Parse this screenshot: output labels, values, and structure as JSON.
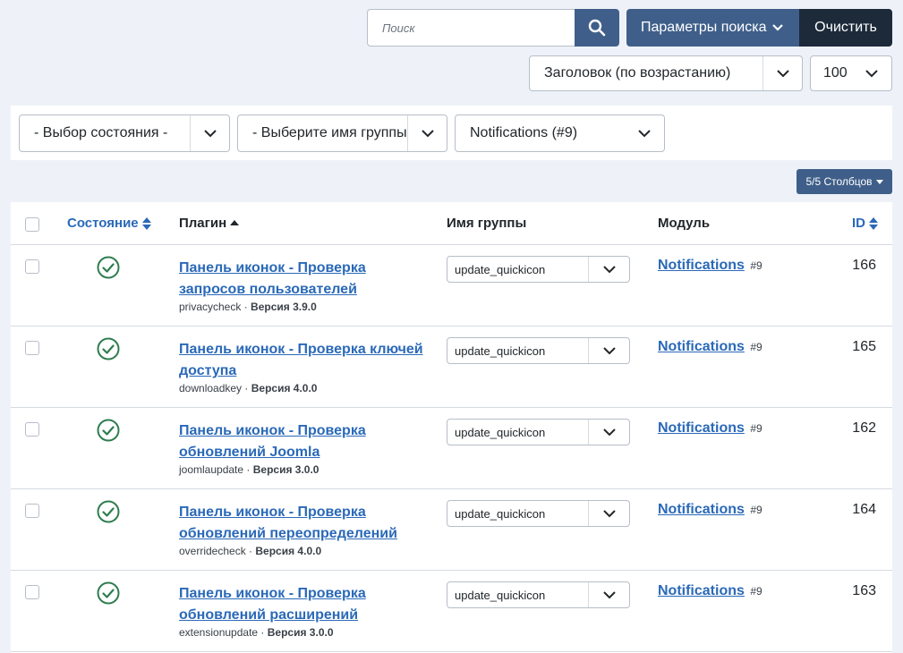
{
  "search": {
    "placeholder": "Поиск",
    "params_label": "Параметры поиска",
    "clear_label": "Очистить"
  },
  "ordering": {
    "sort_value": "Заголовок (по возрастанию)",
    "limit_value": "100"
  },
  "filters": {
    "state": "- Выбор состояния -",
    "group": "- Выберите имя группы",
    "module": "Notifications (#9)"
  },
  "columns_button": "5/5 Столбцов",
  "table": {
    "headers": {
      "state": "Состояние",
      "plugin": "Плагин",
      "group": "Имя группы",
      "module": "Модуль",
      "id": "ID"
    },
    "rows": [
      {
        "title_line1": "Панель иконок - Проверка",
        "title_line2": "запросов пользователей",
        "element": "privacycheck",
        "version_label": "Версия 3.9.0",
        "group": "update_quickicon",
        "module": "Notifications",
        "module_num": "#9",
        "id": "166"
      },
      {
        "title_line1": "Панель иконок - Проверка ключей",
        "title_line2": "доступа",
        "element": "downloadkey",
        "version_label": "Версия 4.0.0",
        "group": "update_quickicon",
        "module": "Notifications",
        "module_num": "#9",
        "id": "165"
      },
      {
        "title_line1": "Панель иконок - Проверка",
        "title_line2": "обновлений Joomla",
        "element": "joomlaupdate",
        "version_label": "Версия 3.0.0",
        "group": "update_quickicon",
        "module": "Notifications",
        "module_num": "#9",
        "id": "162"
      },
      {
        "title_line1": "Панель иконок - Проверка",
        "title_line2": "обновлений переопределений",
        "element": "overridecheck",
        "version_label": "Версия 4.0.0",
        "group": "update_quickicon",
        "module": "Notifications",
        "module_num": "#9",
        "id": "164"
      },
      {
        "title_line1": "Панель иконок - Проверка",
        "title_line2": "обновлений расширений",
        "element": "extensionupdate",
        "version_label": "Версия 3.0.0",
        "group": "update_quickicon",
        "module": "Notifications",
        "module_num": "#9",
        "id": "163"
      }
    ]
  },
  "colors": {
    "accent": "#3f5f8a",
    "link": "#2a69b8",
    "enabled": "#2f7d4f"
  },
  "icons": {
    "search": "search-icon",
    "state": "check-circle-icon",
    "chevron": "chevron-down-icon"
  }
}
